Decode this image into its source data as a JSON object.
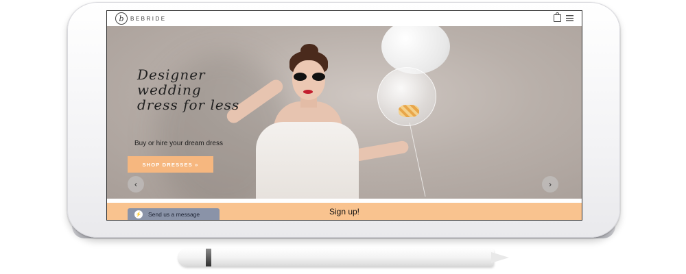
{
  "brand": {
    "logo_letter": "b",
    "logo_text": "BEBRIDE"
  },
  "header": {
    "icons": [
      "bag-icon",
      "menu-icon"
    ]
  },
  "hero": {
    "headline": "Designer wedding dress for less",
    "subtitle": "Buy or hire your dream dress",
    "cta_label": "SHOP DRESSES »",
    "prev_arrow": "‹",
    "next_arrow": "›"
  },
  "footer": {
    "signup_label": "Sign up!",
    "message_label": "Send us a message",
    "message_icon": "messenger-icon"
  },
  "colors": {
    "accent": "#f6b77f",
    "signup_bar": "#f9c38f",
    "message_tab": "#8a93a8"
  }
}
